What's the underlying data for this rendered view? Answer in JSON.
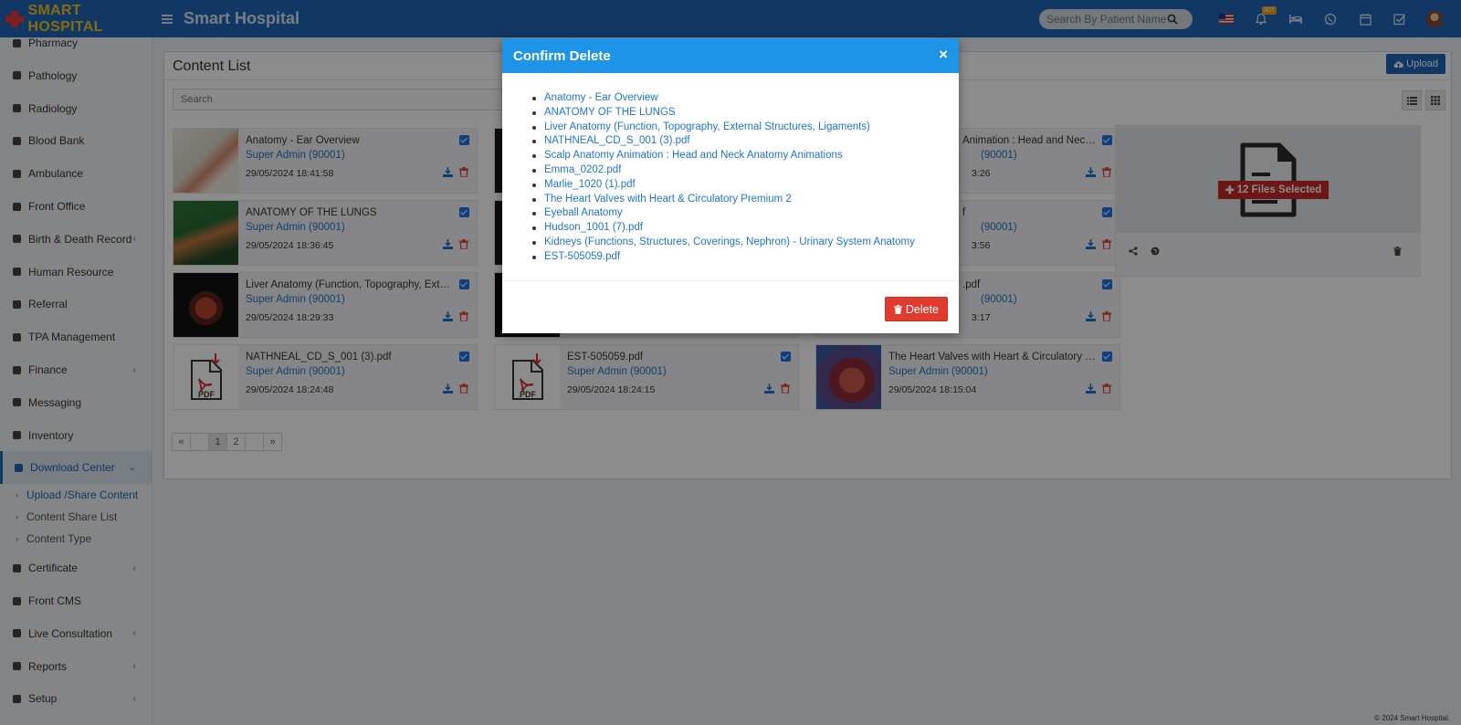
{
  "brand": {
    "logo_text": "SMART HOSPITAL",
    "app_title": "Smart Hospital"
  },
  "header": {
    "search_placeholder": "Search By Patient Name",
    "notification_count": "307",
    "icons": [
      "search-icon",
      "us-flag-icon",
      "bell-icon",
      "bed-icon",
      "whatsapp-icon",
      "calendar-icon",
      "checkbox-icon",
      "avatar"
    ]
  },
  "sidebar": {
    "items": [
      {
        "label": "Pharmacy",
        "icon": "pharmacy-icon",
        "chevron": false
      },
      {
        "label": "Pathology",
        "icon": "flask-icon",
        "chevron": false
      },
      {
        "label": "Radiology",
        "icon": "microscope-icon",
        "chevron": false
      },
      {
        "label": "Blood Bank",
        "icon": "blood-drop-icon",
        "chevron": false
      },
      {
        "label": "Ambulance",
        "icon": "ambulance-icon",
        "chevron": false
      },
      {
        "label": "Front Office",
        "icon": "dumpster-icon",
        "chevron": false
      },
      {
        "label": "Birth & Death Record",
        "icon": "family-icon",
        "chevron": true
      },
      {
        "label": "Human Resource",
        "icon": "sitemap-icon",
        "chevron": false
      },
      {
        "label": "Referral",
        "icon": "users-icon",
        "chevron": false
      },
      {
        "label": "TPA Management",
        "icon": "umbrella-icon",
        "chevron": false
      },
      {
        "label": "Finance",
        "icon": "money-icon",
        "chevron": true
      },
      {
        "label": "Messaging",
        "icon": "bullhorn-icon",
        "chevron": false
      },
      {
        "label": "Inventory",
        "icon": "chart-icon",
        "chevron": false
      },
      {
        "label": "Download Center",
        "icon": "download-icon",
        "chevron": true,
        "active": true
      },
      {
        "label": "Certificate",
        "icon": "certificate-icon",
        "chevron": true
      },
      {
        "label": "Front CMS",
        "icon": "cms-icon",
        "chevron": false
      },
      {
        "label": "Live Consultation",
        "icon": "video-icon",
        "chevron": true
      },
      {
        "label": "Reports",
        "icon": "line-chart-icon",
        "chevron": true
      },
      {
        "label": "Setup",
        "icon": "gears-icon",
        "chevron": true
      }
    ],
    "subitems": [
      {
        "label": "Upload /Share Content",
        "active": true
      },
      {
        "label": "Content Share List",
        "active": false
      },
      {
        "label": "Content Type",
        "active": false
      }
    ]
  },
  "content": {
    "title": "Content List",
    "upload_label": "Upload",
    "search_placeholder": "Search",
    "cards": [
      {
        "title": "Anatomy - Ear Overview",
        "author": "Super Admin (90001)",
        "date": "29/05/2024 18:41:58",
        "thumb": "ear"
      },
      {
        "title": "ANATOMY OF THE LUNGS",
        "author": "Super Admin (90001)",
        "date": "29/05/2024 18:36:45",
        "thumb": "lungs"
      },
      {
        "title": "Liver Anatomy (Function, Topography, External Structures, Ligaments)",
        "author": "Super Admin (90001)",
        "date": "29/05/2024 18:29:33",
        "thumb": "liver"
      },
      {
        "title": "NATHNEAL_CD_S_001 (3).pdf",
        "author": "Super Admin (90001)",
        "date": "29/05/2024 18:24:48",
        "thumb": "pdf"
      },
      {
        "title": "EST-505059.pdf",
        "author": "Super Admin (90001)",
        "date": "29/05/2024 18:24:15",
        "thumb": "pdf"
      },
      {
        "title": "The Heart Valves with Heart & Circulatory Premium 2",
        "author": "Super Admin (90001)",
        "date": "29/05/2024 18:15:04",
        "thumb": "heart"
      }
    ],
    "partial_cards": [
      {
        "title": "Animation : Head and Neck A...",
        "author": "(90001)",
        "date": "3:26"
      },
      {
        "title": "f",
        "author": "(90001)",
        "date": "3:56"
      },
      {
        "title": ".pdf",
        "author": "(90001)",
        "date": "3:17"
      }
    ],
    "files_selected": "12 Files Selected",
    "pagination": [
      "«",
      "",
      "1",
      "2",
      "",
      "»"
    ]
  },
  "footer": {
    "copyright": "© 2024 Smart Hospital."
  },
  "modal": {
    "title": "Confirm Delete",
    "close": "×",
    "items": [
      "Anatomy - Ear Overview",
      "ANATOMY OF THE LUNGS",
      "Liver Anatomy (Function, Topography, External Structures, Ligaments)",
      "NATHNEAL_CD_S_001 (3).pdf",
      "Scalp Anatomy Animation : Head and Neck Anatomy Animations",
      "Emma_0202.pdf",
      "Marlie_1020 (1).pdf",
      "The Heart Valves with Heart & Circulatory Premium 2",
      "Eyeball Anatomy",
      "Hudson_1001 (7).pdf",
      "Kidneys (Functions, Structures, Coverings, Nephron) - Urinary System Anatomy",
      "EST-505059.pdf"
    ],
    "delete_label": "Delete"
  },
  "colors": {
    "header": "#1f64b9",
    "modal_header": "#1e94e6",
    "delete": "#e03b2f",
    "link": "#1f74c4",
    "selected_badge": "#c62828"
  }
}
